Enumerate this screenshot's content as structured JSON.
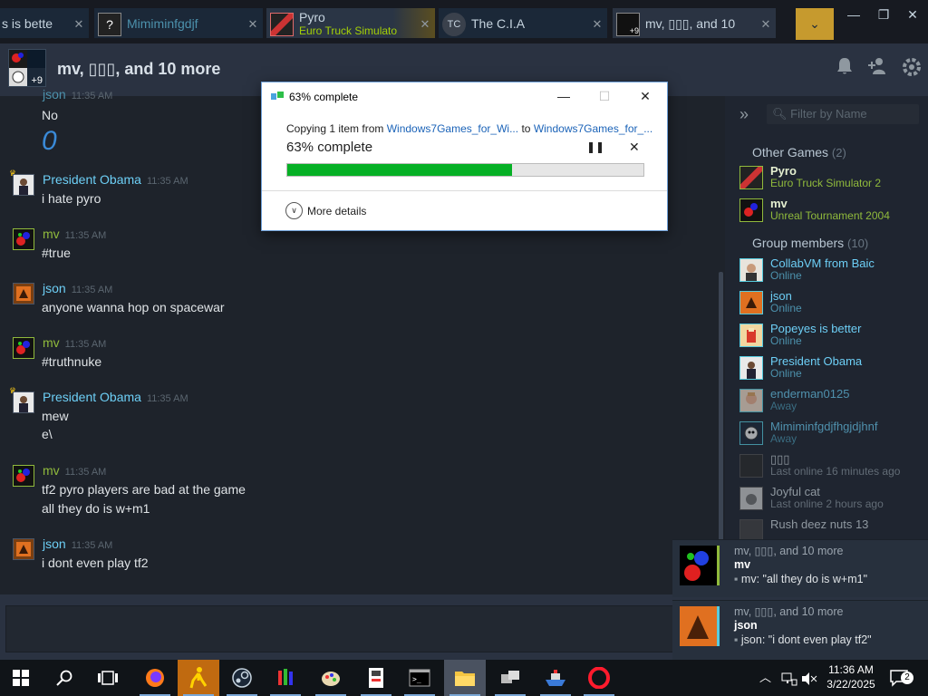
{
  "tabs": [
    {
      "title": "s is bette",
      "subtitle": "",
      "close": "✕"
    },
    {
      "title": "Mimiminfgdjf",
      "subtitle": "",
      "close": "✕",
      "avatar_text": "?"
    },
    {
      "title": "Pyro",
      "subtitle": "Euro Truck Simulato",
      "close": "✕"
    },
    {
      "title": "The C.I.A",
      "subtitle": "",
      "close": "✕",
      "avatar_text": "TC"
    },
    {
      "title": "mv, ▯▯▯, and 10",
      "subtitle": "",
      "close": "✕",
      "avatar_badge": "+9"
    }
  ],
  "window_controls": {
    "minimize": "—",
    "restore": "❐",
    "close": "✕",
    "dropdown": "⌄"
  },
  "chat": {
    "avatar_badge": "+9",
    "title": "mv, ▯▯▯, and 10 more",
    "messages": [
      {
        "sender": "json",
        "time": "11:35 AM",
        "lines": [
          "No",
          "0"
        ],
        "type": "friend"
      },
      {
        "sender": "President Obama",
        "time": "11:35 AM",
        "lines": [
          "i hate pyro"
        ],
        "type": "friend"
      },
      {
        "sender": "mv",
        "time": "11:35 AM",
        "lines": [
          "#true"
        ],
        "type": "ingame"
      },
      {
        "sender": "json",
        "time": "11:35 AM",
        "lines": [
          "anyone wanna hop on spacewar"
        ],
        "type": "friend"
      },
      {
        "sender": "mv",
        "time": "11:35 AM",
        "lines": [
          "#truthnuke"
        ],
        "type": "ingame"
      },
      {
        "sender": "President Obama",
        "time": "11:35 AM",
        "lines": [
          "mew",
          "e\\"
        ],
        "type": "friend"
      },
      {
        "sender": "mv",
        "time": "11:35 AM",
        "lines": [
          "tf2 pyro players are bad at the game",
          "all they do is w+m1"
        ],
        "type": "ingame"
      },
      {
        "sender": "json",
        "time": "11:35 AM",
        "lines": [
          "i dont even play tf2"
        ],
        "type": "friend"
      }
    ]
  },
  "panel": {
    "filter_placeholder": "Filter by Name",
    "other_games_label": "Other Games",
    "other_games_count": "(2)",
    "other_games": [
      {
        "name": "Pyro",
        "status": "Euro Truck Simulator 2"
      },
      {
        "name": "mv",
        "status": "Unreal Tournament 2004"
      }
    ],
    "group_members_label": "Group members",
    "group_members_count": "(10)",
    "members": [
      {
        "name": "CollabVM from Baic",
        "status": "Online",
        "state": "online"
      },
      {
        "name": "json",
        "status": "Online",
        "state": "online"
      },
      {
        "name": "Popeyes is better",
        "status": "Online",
        "state": "online"
      },
      {
        "name": "President Obama",
        "status": "Online",
        "state": "online"
      },
      {
        "name": "enderman0125",
        "status": "Away",
        "state": "away"
      },
      {
        "name": "Mimiminfgdjfhgjdjhnf",
        "status": "Away",
        "state": "away"
      },
      {
        "name": "▯▯▯",
        "status": "Last online 16 minutes ago",
        "state": "offline"
      },
      {
        "name": "Joyful cat",
        "status": "Last online 2 hours ago",
        "state": "offline"
      },
      {
        "name": "Rush deez nuts 13",
        "status": "",
        "state": "offline"
      }
    ]
  },
  "toasts": [
    {
      "group": "mv, ▯▯▯, and 10 more",
      "sender": "mv",
      "message": "mv: \"all they do is w+m1\""
    },
    {
      "group": "mv, ▯▯▯, and 10 more",
      "sender": "json",
      "message": "json: \"i dont even play tf2\""
    }
  ],
  "copy_dialog": {
    "title": "63% complete",
    "copying_prefix": "Copying 1 item from",
    "source": "Windows7Games_for_Wi...",
    "to_word": "to",
    "destination": "Windows7Games_for_...",
    "percent_text": "63% complete",
    "progress": 0.63,
    "pause": "❚❚",
    "cancel": "✕",
    "more_details": "More details",
    "minimize": "—",
    "maximize": "☐",
    "close": "✕"
  },
  "taskbar": {
    "clock_time": "11:36 AM",
    "clock_date": "3/22/2025",
    "notification_count": "2",
    "progress_color": "#06b025",
    "accent_color": "#c69a2e"
  }
}
